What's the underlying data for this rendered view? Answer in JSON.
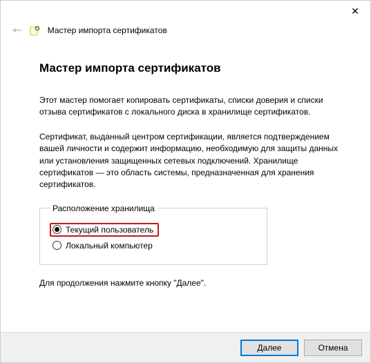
{
  "window": {
    "wizard_label": "Мастер импорта сертификатов"
  },
  "page": {
    "heading": "Мастер импорта сертификатов",
    "intro": "Этот мастер помогает копировать сертификаты, списки доверия и списки отзыва сертификатов с локального диска в хранилище сертификатов.",
    "explain": "Сертификат, выданный центром сертификации, является подтверждением вашей личности и содержит информацию, необходимую для защиты данных или установления защищенных сетевых подключений. Хранилище сертификатов — это область системы, предназначенная для хранения сертификатов.",
    "group_legend": "Расположение хранилища",
    "options": {
      "current_user": "Текущий пользователь",
      "local_machine": "Локальный компьютер"
    },
    "continue_hint": "Для продолжения нажмите кнопку \"Далее\"."
  },
  "buttons": {
    "next": "Далее",
    "cancel": "Отмена"
  }
}
